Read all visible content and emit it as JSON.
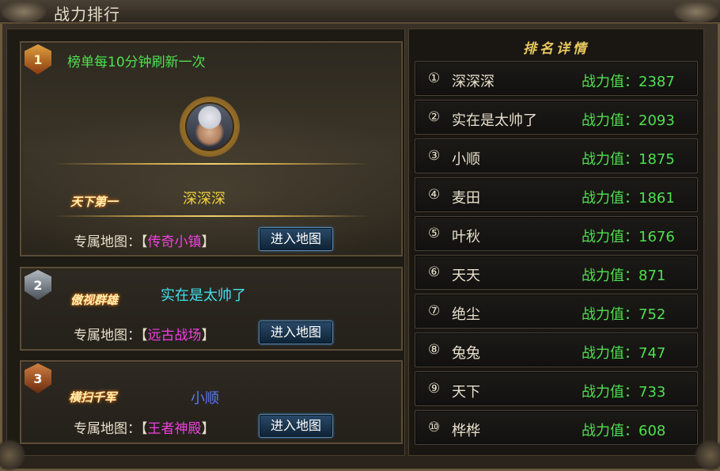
{
  "window": {
    "title": "战力排行"
  },
  "left": {
    "refresh_note": "榜单每10分钟刷新一次",
    "map_prefix": "专属地图：",
    "bracket_open": "【",
    "bracket_close": "】",
    "enter_label": "进入地图",
    "top3": [
      {
        "rank": "1",
        "honor": "天下第一",
        "name": "深深深",
        "map": "传奇小镇"
      },
      {
        "rank": "2",
        "honor": "傲视群雄",
        "name": "实在是太帅了",
        "map": "远古战场"
      },
      {
        "rank": "3",
        "honor": "横扫千军",
        "name": "小顺",
        "map": "王者神殿"
      }
    ]
  },
  "right": {
    "title": "排名详情",
    "power_label": "战力值：",
    "rows": [
      {
        "num": "①",
        "name": "深深深",
        "power": "2387"
      },
      {
        "num": "②",
        "name": "实在是太帅了",
        "power": "2093"
      },
      {
        "num": "③",
        "name": "小顺",
        "power": "1875"
      },
      {
        "num": "④",
        "name": "麦田",
        "power": "1861"
      },
      {
        "num": "⑤",
        "name": "叶秋",
        "power": "1676"
      },
      {
        "num": "⑥",
        "name": "天天",
        "power": "871"
      },
      {
        "num": "⑦",
        "name": "绝尘",
        "power": "752"
      },
      {
        "num": "⑧",
        "name": "兔兔",
        "power": "747"
      },
      {
        "num": "⑨",
        "name": "天下",
        "power": "733"
      },
      {
        "num": "⑩",
        "name": "桦桦",
        "power": "608"
      }
    ]
  },
  "colors": {
    "accent_gold": "#e8c860",
    "power_green": "#4ee04e",
    "map_magenta": "#f040e0",
    "button_blue": "#2a4a6a"
  }
}
